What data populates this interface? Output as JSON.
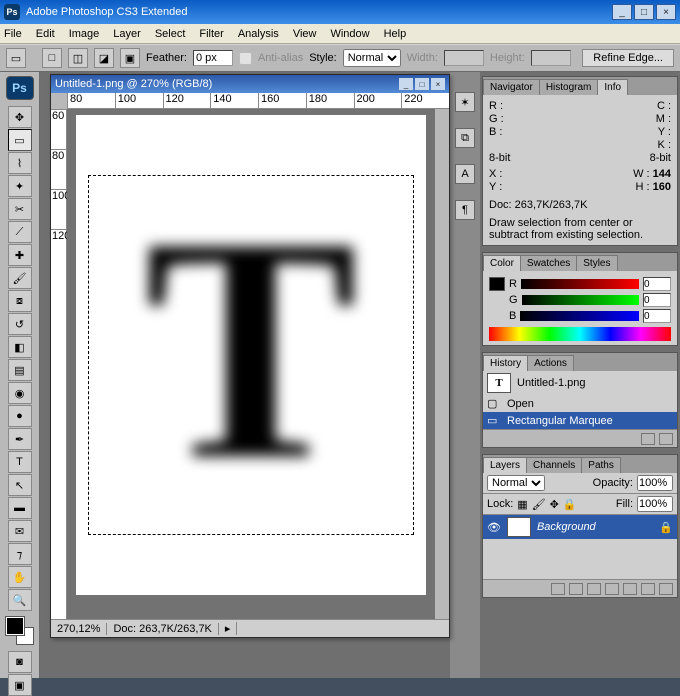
{
  "app": {
    "title": "Adobe Photoshop CS3 Extended"
  },
  "menu": [
    "File",
    "Edit",
    "Image",
    "Layer",
    "Select",
    "Filter",
    "Analysis",
    "View",
    "Window",
    "Help"
  ],
  "options": {
    "feather_label": "Feather:",
    "feather_value": "0 px",
    "antialias": "Anti-alias",
    "style_label": "Style:",
    "style_value": "Normal",
    "width_label": "Width:",
    "height_label": "Height:",
    "refine": "Refine Edge..."
  },
  "doc": {
    "title": "Untitled-1.png @ 270% (RGB/8)",
    "ruler_h": [
      "80",
      "100",
      "120",
      "140",
      "160",
      "180",
      "200",
      "220"
    ],
    "ruler_v": [
      "60",
      "80",
      "100",
      "120"
    ],
    "zoom": "270,12%",
    "docsize": "Doc: 263,7K/263,7K"
  },
  "info": {
    "tabs": [
      "Navigator",
      "Histogram",
      "Info"
    ],
    "r": "R :",
    "g": "G :",
    "b": "B :",
    "c": "C :",
    "m": "M :",
    "y": "Y :",
    "k": "K :",
    "bit": "8-bit",
    "bit2": "8-bit",
    "x": "X :",
    "yy": "Y :",
    "w": "W :",
    "h": "H :",
    "wv": "144",
    "hv": "160",
    "doc": "Doc: 263,7K/263,7K",
    "hint": "Draw selection from center or subtract from existing selection."
  },
  "color": {
    "tabs": [
      "Color",
      "Swatches",
      "Styles"
    ],
    "r": "R",
    "g": "G",
    "b": "B",
    "rv": "0",
    "gv": "0",
    "bv": "0"
  },
  "history": {
    "tabs": [
      "History",
      "Actions"
    ],
    "snap": "Untitled-1.png",
    "items": [
      "Open",
      "Rectangular Marquee"
    ]
  },
  "layers": {
    "tabs": [
      "Layers",
      "Channels",
      "Paths"
    ],
    "mode": "Normal",
    "opacity_l": "Opacity:",
    "opacity_v": "100%",
    "lock": "Lock:",
    "fill_l": "Fill:",
    "fill_v": "100%",
    "bg": "Background"
  }
}
